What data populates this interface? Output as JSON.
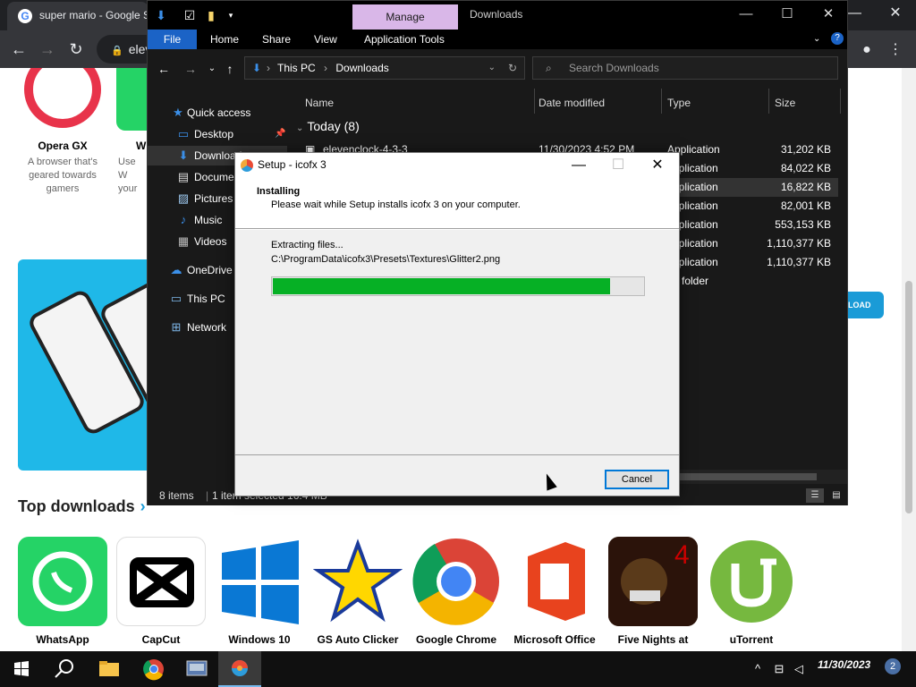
{
  "browser": {
    "tab_title": "super mario - Google S",
    "omnibox_text": "elev",
    "controls": {
      "minimize": "—",
      "maximize": "❐",
      "close": "✕"
    },
    "page": {
      "apps_top": [
        {
          "name": "Opera GX",
          "desc": "A browser that's geared towards gamers"
        },
        {
          "name": "W",
          "desc": "Use W your"
        }
      ],
      "download_button": "LOAD",
      "top_downloads_heading": "Top downloads",
      "top_downloads": [
        {
          "label": "WhatsApp",
          "color": "#25d366"
        },
        {
          "label": "CapCut",
          "color": "#ffffff"
        },
        {
          "label": "Windows 10",
          "color": "#0a78d4"
        },
        {
          "label": "GS Auto Clicker",
          "color": "#ffffff"
        },
        {
          "label": "Google Chrome",
          "color": "#ffffff"
        },
        {
          "label": "Microsoft Office",
          "color": "#ffffff"
        },
        {
          "label": "Five Nights at",
          "color": "#3a1a0a"
        },
        {
          "label": "uTorrent",
          "color": "#ffffff"
        }
      ]
    }
  },
  "explorer": {
    "manage_tab": "Manage",
    "window_title": "Downloads",
    "ribbon_tabs": [
      "File",
      "Home",
      "Share",
      "View",
      "Application Tools"
    ],
    "breadcrumb": [
      "This PC",
      "Downloads"
    ],
    "search_placeholder": "Search Downloads",
    "nav_items": [
      {
        "label": "Quick access",
        "icon": "star-icon"
      },
      {
        "label": "Desktop",
        "icon": "desktop-icon"
      },
      {
        "label": "Downloads",
        "icon": "download-icon"
      },
      {
        "label": "Documents",
        "icon": "document-icon"
      },
      {
        "label": "Pictures",
        "icon": "picture-icon"
      },
      {
        "label": "Music",
        "icon": "music-icon"
      },
      {
        "label": "Videos",
        "icon": "video-icon"
      },
      {
        "label": "OneDrive",
        "icon": "cloud-icon"
      },
      {
        "label": "This PC",
        "icon": "pc-icon"
      },
      {
        "label": "Network",
        "icon": "network-icon"
      }
    ],
    "columns": [
      "Name",
      "Date modified",
      "Type",
      "Size"
    ],
    "group_header": "Today (8)",
    "rows": [
      {
        "name": "elevenclock-4-3-3",
        "date": "11/30/2023 4:52 PM",
        "type": "Application",
        "size": "31,202 KB"
      },
      {
        "name": "",
        "date": "",
        "type": "pplication",
        "size": "84,022 KB"
      },
      {
        "name": "",
        "date": "",
        "type": "pplication",
        "size": "16,822 KB"
      },
      {
        "name": "",
        "date": "",
        "type": "pplication",
        "size": "82,001 KB"
      },
      {
        "name": "",
        "date": "",
        "type": "pplication",
        "size": "553,153 KB"
      },
      {
        "name": "",
        "date": "",
        "type": "pplication",
        "size": "1,110,377 KB"
      },
      {
        "name": "",
        "date": "",
        "type": "pplication",
        "size": "1,110,377 KB"
      },
      {
        "name": "",
        "date": "",
        "type": "e folder",
        "size": ""
      }
    ],
    "status_items": "8 items",
    "status_selected": "1 item selected  16.4 MB"
  },
  "setup": {
    "title": "Setup - icofx 3",
    "heading": "Installing",
    "subheading": "Please wait while Setup installs icofx 3 on your computer.",
    "status": "Extracting files...",
    "file_path": "C:\\ProgramData\\icofx3\\Presets\\Textures\\Glitter2.png",
    "progress_fraction": 0.91,
    "cancel_label": "Cancel"
  },
  "taskbar": {
    "time": "11/30/2023",
    "notification_count": "2"
  }
}
